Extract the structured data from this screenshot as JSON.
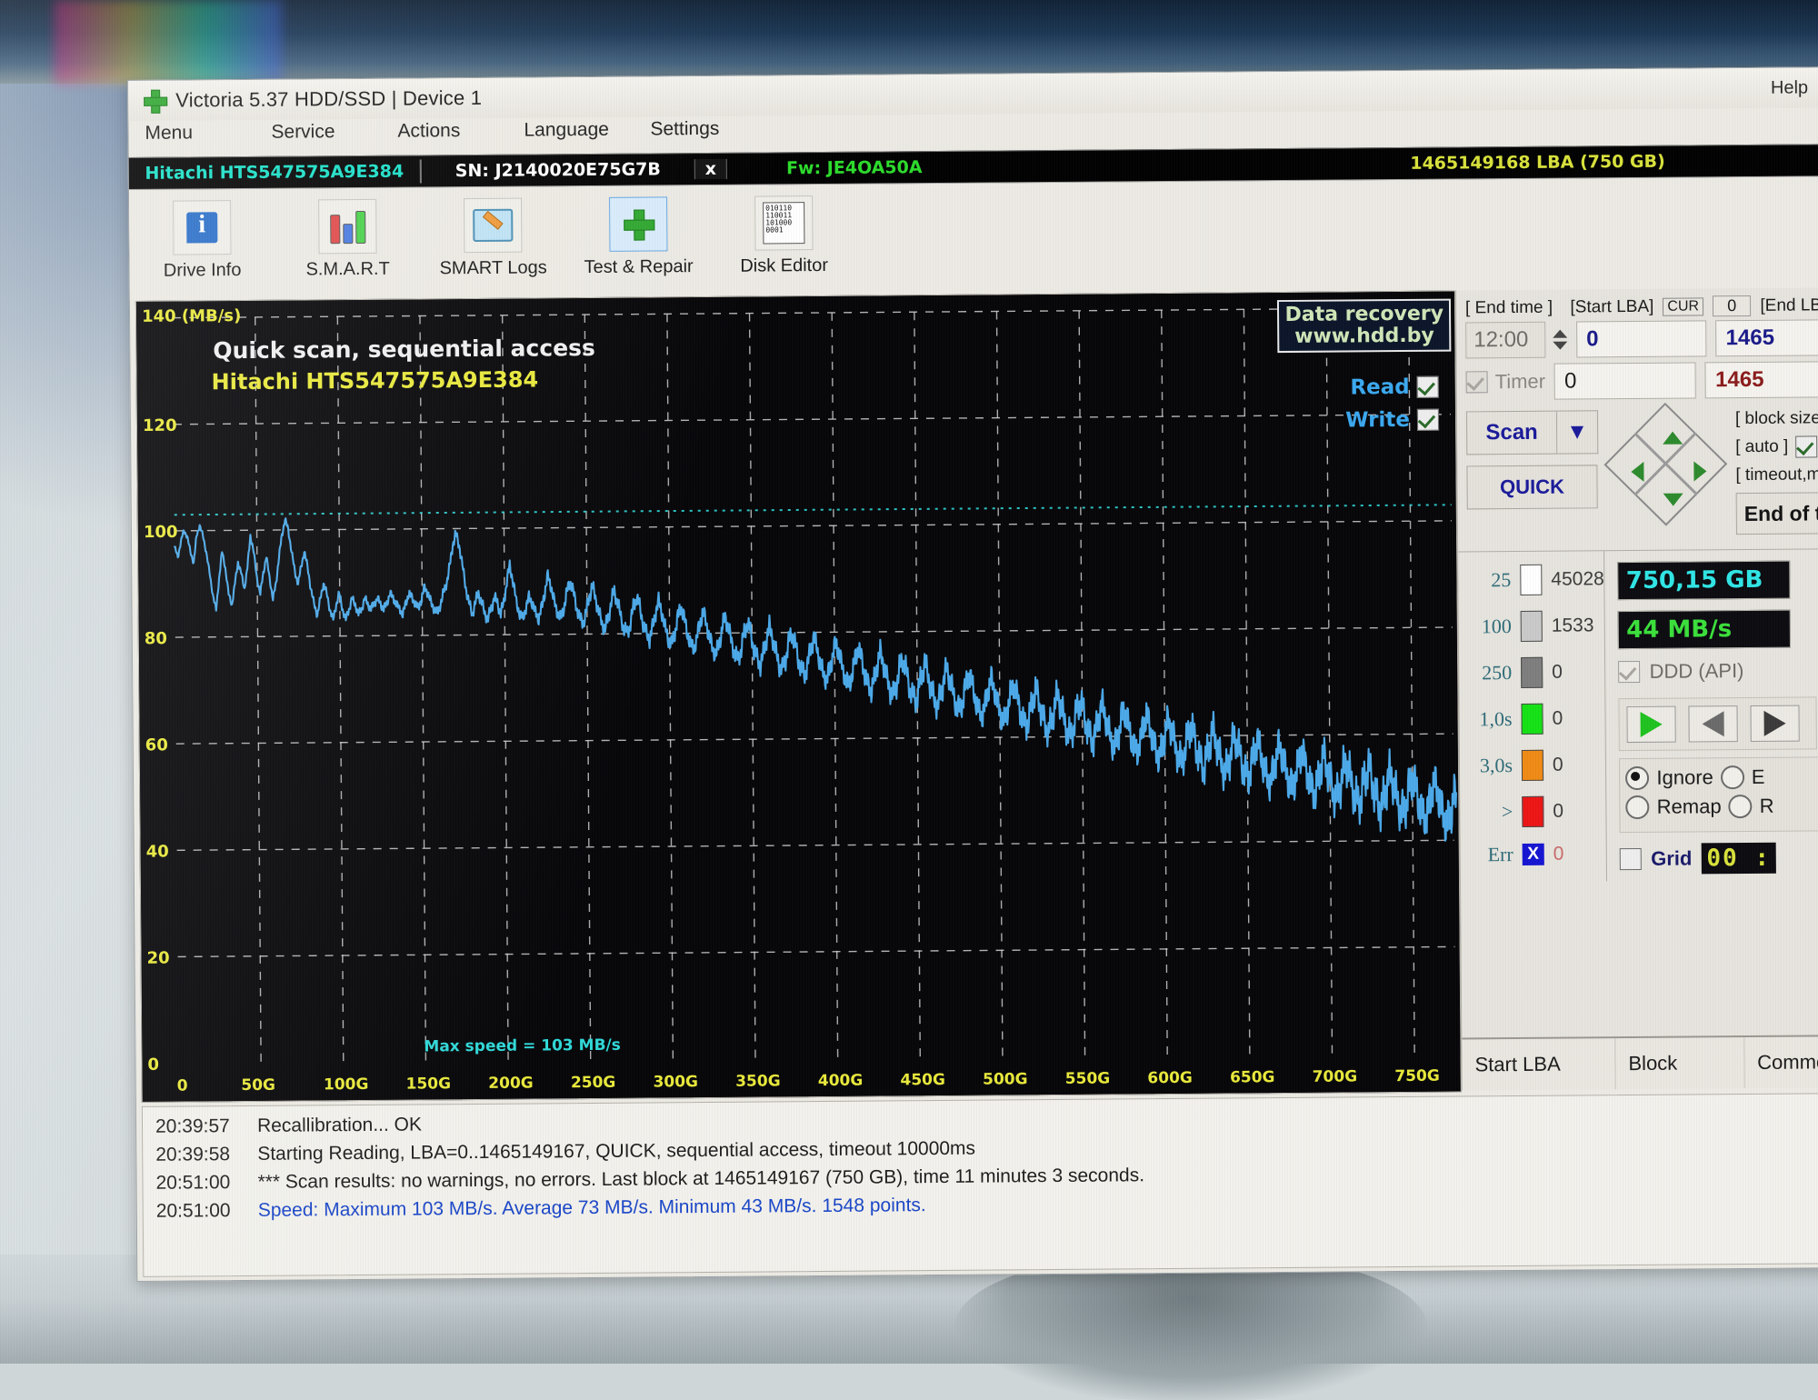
{
  "window": {
    "title": "Victoria 5.37 HDD/SSD | Device 1",
    "help_label": "Help",
    "logo_icon": "green-cross-icon"
  },
  "menubar": {
    "items": [
      "Menu",
      "Service",
      "Actions",
      "Language",
      "Settings"
    ]
  },
  "device_bar": {
    "model": "Hitachi HTS547575A9E384",
    "serial": "SN: J2140020E75G7B",
    "close_label": "x",
    "firmware": "Fw: JE4OA50A",
    "capacity_lba": "1465149168 LBA (750 GB)"
  },
  "toolbar": {
    "items": [
      {
        "label": "Drive Info",
        "icon": "info-icon",
        "selected": false
      },
      {
        "label": "S.M.A.R.T",
        "icon": "test-tubes-icon",
        "selected": false
      },
      {
        "label": "SMART Logs",
        "icon": "folder-pencil-icon",
        "selected": false
      },
      {
        "label": "Test & Repair",
        "icon": "green-cross-icon",
        "selected": true
      },
      {
        "label": "Disk Editor",
        "icon": "binary-page-icon",
        "selected": false
      }
    ],
    "binary_icon_text": "010110\n110011\n101000\n0001"
  },
  "chart_overlay": {
    "title": "Quick scan, sequential access",
    "subtitle": "Hitachi HTS547575A9E384",
    "unit_label": "140 (MB/s)",
    "max_speed_note": "Max speed = 103 MB/s",
    "logo_line1": "Data recovery",
    "logo_line2": "www.hdd.by",
    "read_label": "Read",
    "write_label": "Write",
    "read_checked": true,
    "write_checked": true
  },
  "chart_data": {
    "type": "line",
    "title": "Quick scan, sequential access",
    "subtitle": "Hitachi HTS547575A9E384",
    "xlabel": "",
    "ylabel": "MB/s",
    "ylim": [
      0,
      140
    ],
    "yticks": [
      0,
      20,
      40,
      60,
      80,
      100,
      120,
      140
    ],
    "ytick_labels": [
      "0",
      "20",
      "40",
      "60",
      "80",
      "100",
      "120",
      "140 (MB/s)"
    ],
    "xlim": [
      0,
      775
    ],
    "xticks": [
      0,
      50,
      100,
      150,
      200,
      250,
      300,
      350,
      400,
      450,
      500,
      550,
      600,
      650,
      700,
      750
    ],
    "xtick_labels": [
      "0",
      "50G",
      "100G",
      "150G",
      "200G",
      "250G",
      "300G",
      "350G",
      "400G",
      "450G",
      "500G",
      "550G",
      "600G",
      "650G",
      "700G",
      "750G"
    ],
    "grid": true,
    "series": [
      {
        "name": "Read speed",
        "color": "#4aa8e8",
        "annotation": "Max speed = 103 MB/s",
        "max": 103,
        "average": 73,
        "min": 43,
        "points": 1548,
        "values": [
          97,
          95,
          98,
          100,
          99,
          96,
          94,
          99,
          101,
          99,
          96,
          92,
          88,
          85,
          91,
          96,
          93,
          88,
          86,
          90,
          94,
          92,
          89,
          93,
          99,
          96,
          91,
          88,
          92,
          95,
          91,
          87,
          90,
          95,
          99,
          102,
          100,
          96,
          92,
          90,
          93,
          96,
          93,
          89,
          86,
          84,
          87,
          90,
          88,
          85,
          83,
          86,
          88,
          85,
          83,
          85,
          87,
          86,
          84,
          85,
          87,
          86,
          85,
          86,
          87,
          86,
          85,
          86,
          88,
          87,
          86,
          85,
          84,
          86,
          88,
          87,
          86,
          85,
          87,
          89,
          88,
          86,
          85,
          84,
          86,
          88,
          90,
          93,
          97,
          99,
          97,
          93,
          89,
          86,
          84,
          86,
          88,
          86,
          84,
          83,
          85,
          87,
          86,
          84,
          86,
          90,
          93,
          90,
          86,
          84,
          83,
          85,
          87,
          86,
          84,
          83,
          85,
          88,
          91,
          89,
          86,
          84,
          83,
          85,
          88,
          90,
          88,
          85,
          83,
          82,
          84,
          87,
          89,
          87,
          84,
          82,
          81,
          83,
          86,
          88,
          86,
          83,
          81,
          80,
          82,
          85,
          87,
          85,
          82,
          80,
          79,
          81,
          84,
          86,
          84,
          81,
          79,
          78,
          80,
          83,
          85,
          83,
          80,
          78,
          77,
          79,
          82,
          84,
          82,
          79,
          77,
          76,
          78,
          81,
          83,
          81,
          78,
          76,
          75,
          77,
          80,
          82,
          80,
          77,
          75,
          74,
          76,
          79,
          81,
          79,
          76,
          74,
          73,
          75,
          78,
          80,
          78,
          75,
          73,
          72,
          74,
          77,
          79,
          77,
          74,
          72,
          71,
          73,
          76,
          78,
          76,
          73,
          71,
          70,
          72,
          75,
          77,
          75,
          72,
          70,
          69,
          71,
          74,
          76,
          74,
          71,
          69,
          68,
          70,
          73,
          75,
          73,
          70,
          68,
          67,
          69,
          72,
          74,
          72,
          69,
          67,
          66,
          68,
          71,
          73,
          71,
          68,
          66,
          65,
          67,
          70,
          72,
          70,
          67,
          65,
          64,
          66,
          69,
          71,
          69,
          66,
          64,
          63,
          65,
          68,
          70,
          68,
          65,
          63,
          62,
          64,
          67,
          69,
          67,
          64,
          62,
          61,
          63,
          66,
          68,
          66,
          63,
          61,
          60,
          62,
          65,
          67,
          65,
          62,
          60,
          59,
          61,
          64,
          66,
          64,
          61,
          59,
          58,
          60,
          63,
          65,
          63,
          60,
          58,
          57,
          59,
          62,
          64,
          62,
          59,
          57,
          56,
          58,
          61,
          63,
          61,
          58,
          56,
          55,
          57,
          60,
          62,
          60,
          57,
          55,
          54,
          56,
          59,
          61,
          59,
          56,
          54,
          53,
          55,
          58,
          60,
          58,
          55,
          53,
          52,
          54,
          57,
          59,
          57,
          54,
          52,
          51,
          53,
          56,
          58,
          56,
          53,
          51,
          50,
          52,
          55,
          57,
          55,
          52,
          50,
          49,
          51,
          54,
          56,
          54,
          51,
          49,
          48,
          50,
          53,
          55,
          53,
          50,
          48,
          47,
          49,
          52,
          54,
          52,
          49,
          47,
          46,
          48,
          51,
          53,
          51,
          48,
          46,
          45,
          47,
          50,
          52,
          50,
          47,
          45,
          44,
          46,
          49,
          51,
          49,
          46,
          44,
          43,
          45,
          48
        ]
      }
    ]
  },
  "scan_panel": {
    "end_time_label": "[ End time ]",
    "end_time_value": "12:00",
    "timer_label": "Timer",
    "timer_checked": true,
    "start_lba_label": "[Start LBA]",
    "cur_label": "CUR",
    "cur_value": "0",
    "start_lba_value": "0",
    "start_lba_value2": "0",
    "end_lba_label": "[End LBA]",
    "end_lba_value": "1465",
    "end_lba_value2": "1465",
    "scan_button": "Scan",
    "quick_button": "QUICK",
    "block_size_label": "[ block size ]",
    "auto_label": "[ auto ]",
    "auto_checked": true,
    "timeout_label": "[ timeout,ms ]",
    "end_of_test_label": "End of te",
    "dpad_icon": "dpad-diamond-icon"
  },
  "block_stats": {
    "rows": [
      {
        "threshold": "25",
        "color": "#ffffff",
        "count": "45028"
      },
      {
        "threshold": "100",
        "color": "#c9c9c9",
        "count": "1533"
      },
      {
        "threshold": "250",
        "color": "#7d7d7d",
        "count": "0"
      },
      {
        "threshold": "1,0s",
        "color": "#14e114",
        "count": "0"
      },
      {
        "threshold": "3,0s",
        "color": "#f08a14",
        "count": "0"
      },
      {
        "threshold": ">",
        "color": "#ed1414",
        "count": "0"
      },
      {
        "threshold": "Err",
        "color": "#1414d2",
        "count": "0"
      }
    ]
  },
  "info_panel": {
    "capacity": "750,15 GB",
    "speed": "44 MB/s",
    "ddd_label": "DDD (API)",
    "ddd_checked": false,
    "nav_play_icon": "play-icon",
    "nav_back_icon": "back-icon",
    "nav_next_icon": "next-icon",
    "radio_options": [
      {
        "label": "Ignore",
        "selected": true
      },
      {
        "label": "E",
        "selected": false
      },
      {
        "label": "Remap",
        "selected": false
      },
      {
        "label": "R",
        "selected": false
      }
    ],
    "grid_label": "Grid",
    "grid_checked": false,
    "clock": "00 :"
  },
  "result_table": {
    "columns": [
      "Start LBA",
      "Block",
      "Comment"
    ]
  },
  "log": {
    "lines": [
      {
        "time": "20:39:57",
        "message": "Recallibration... OK",
        "highlight": false
      },
      {
        "time": "20:39:58",
        "message": "Starting Reading, LBA=0..1465149167, QUICK, sequential access, timeout 10000ms",
        "highlight": false
      },
      {
        "time": "20:51:00",
        "message": "*** Scan results: no warnings, no errors. Last block at 1465149167 (750 GB), time 11 minutes 3 seconds.",
        "highlight": false
      },
      {
        "time": "20:51:00",
        "message": "Speed: Maximum 103 MB/s. Average 73 MB/s. Minimum 43 MB/s. 1548 points.",
        "highlight": true
      }
    ]
  },
  "colors": {
    "graph_line": "#4aa8e8",
    "accent_yellow": "#e9e93a",
    "accent_cyan": "#2fe6e6",
    "accent_green": "#3ae03a"
  }
}
